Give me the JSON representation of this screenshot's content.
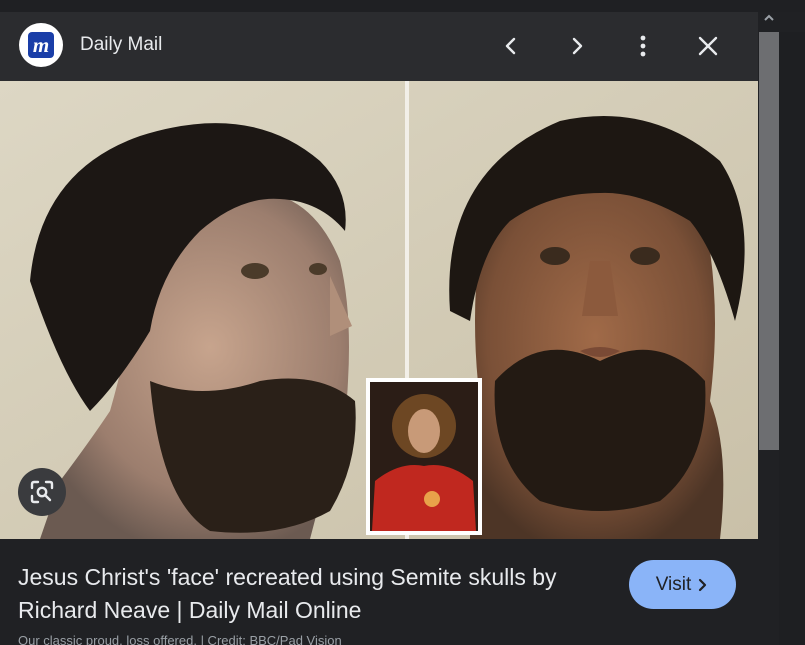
{
  "header": {
    "source_name": "Daily Mail",
    "logo_letter": "m",
    "icons": {
      "prev": "chevron-left-icon",
      "next": "chevron-right-icon",
      "more": "more-vertical-icon",
      "close": "close-icon"
    }
  },
  "image": {
    "description_icon": "lens-icon"
  },
  "result": {
    "title": "Jesus Christ's 'face' recreated using Semite skulls by Richard Neave | Daily Mail Online",
    "visit_label": "Visit",
    "credit_text": "Our classic proud, loss offered. | Credit: BBC/Pad Vision"
  },
  "colors": {
    "panel": "#2a2b2e",
    "page": "#202124",
    "accent": "#8ab4f8",
    "text": "#e8eaed"
  }
}
